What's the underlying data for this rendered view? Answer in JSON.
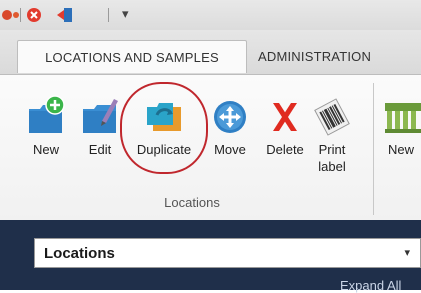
{
  "quick_access": {
    "icons": [
      "app-icon",
      "close-circle-icon",
      "exit-icon",
      "customize-dropdown-icon"
    ],
    "dropdown_symbol": "▾"
  },
  "tabs": {
    "active": "LOCATIONS AND SAMPLES",
    "inactive": "ADMINISTRATION"
  },
  "ribbon": {
    "group_label": "Locations",
    "buttons": {
      "new": "New",
      "edit": "Edit",
      "duplicate": "Duplicate",
      "move": "Move",
      "delete": "Delete",
      "print_label": "Print\nlabel",
      "new_2": "New"
    }
  },
  "location_selector": {
    "value": "Locations",
    "arrow": "▾"
  },
  "footer": {
    "partial_text": "Expand All"
  },
  "colors": {
    "highlight_ring": "#c0272d",
    "dark_panel": "#1f2f4a",
    "ribbon_bg": "#f7f7f7",
    "tab_strip_bg": "#e0e0e0"
  }
}
